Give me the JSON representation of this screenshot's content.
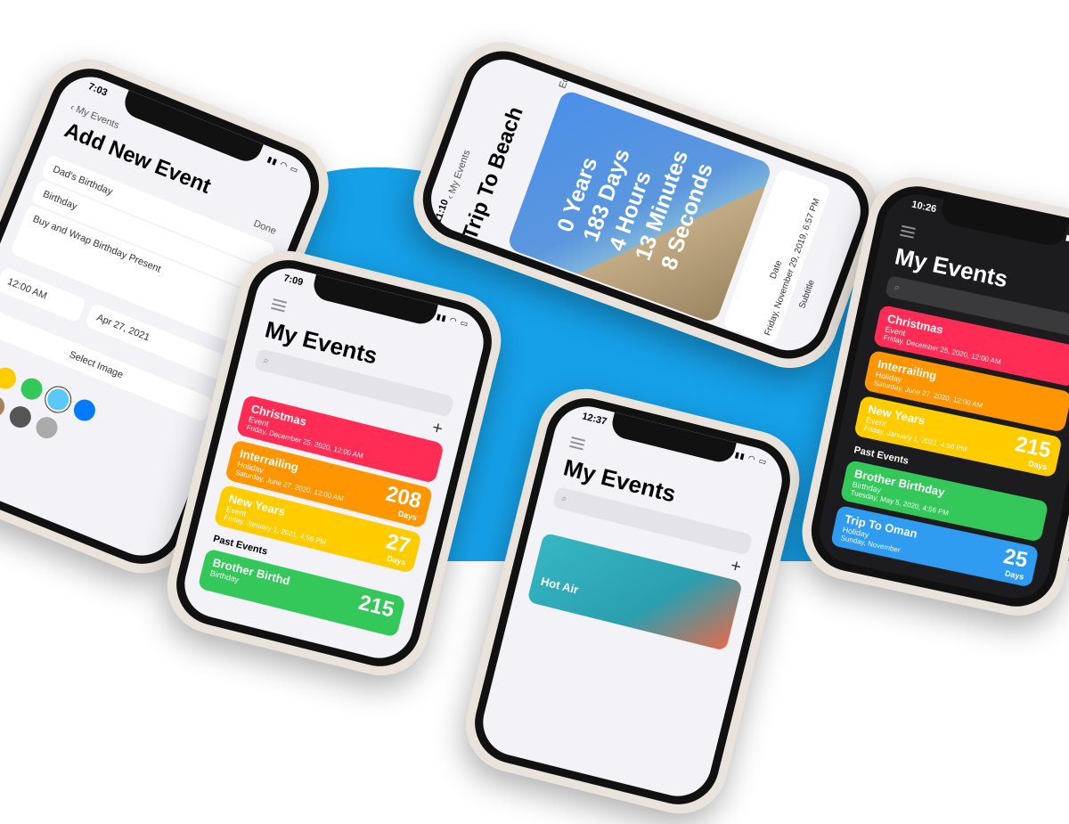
{
  "colors": {
    "background_blue": "#16a0e8",
    "event_red": "#ff2d55",
    "event_orange": "#ff9500",
    "event_yellow": "#ffcc00",
    "event_green": "#34c759",
    "event_blue": "#2f9cf2"
  },
  "phone_add": {
    "time": "7:03",
    "back_label": "My Events",
    "title": "Add New Event",
    "done_label": "Done",
    "name_value": "Dad's Birthday",
    "type_value": "Birthday",
    "notes_value": "Buy and Wrap Birthday Present",
    "time_value": "12:00 AM",
    "date_value": "Apr 27, 2021",
    "select_image_label": "Select Image",
    "swatch_colors": [
      "#ff9500",
      "#ffcc00",
      "#34c759",
      "#5ac8fa",
      "#007aff",
      "#af52de",
      "#a2845e",
      "#555555",
      "#aaaaaa"
    ]
  },
  "phone_list1": {
    "time": "7:09",
    "title": "My Events",
    "search_placeholder": "",
    "plus": "+",
    "events": [
      {
        "title": "Christmas",
        "type": "Event",
        "date": "Friday, December 25, 2020, 12:00 AM"
      },
      {
        "title": "Interrailing",
        "type": "Holiday",
        "date": "Saturday, June 27, 2020, 12:00 AM",
        "count": "208",
        "unit": "Days"
      },
      {
        "title": "New Years",
        "type": "Event",
        "date": "Friday, January 1, 2021, 4:56 PM",
        "count": "27",
        "unit": "Days"
      }
    ],
    "past_label": "Past Events",
    "past_events": [
      {
        "title": "Brother Birthd",
        "type": "Birthday",
        "count": "215"
      }
    ]
  },
  "phone_detail": {
    "time": "11:10",
    "back_label": "My Events",
    "title": "Trip To Beach",
    "edit_label": "Edit",
    "countdown": [
      "0 Years",
      "183 Days",
      "4 Hours",
      "13 Minutes",
      "8 Seconds"
    ],
    "date_label": "Date",
    "date_value": "Friday, November 29, 2019, 6:57 PM",
    "subtitle_label": "Subtitle"
  },
  "phone_list2": {
    "time": "12:37",
    "title": "My Events",
    "plus": "+",
    "card_title": "Hot Air"
  },
  "phone_dark": {
    "time": "10:26",
    "title": "My Events",
    "events": [
      {
        "title": "Christmas",
        "type": "Event",
        "date": "Friday, December 25, 2020, 12:00 AM"
      },
      {
        "title": "Interrailing",
        "type": "Holiday",
        "date": "Saturday, June 27, 2020, 12:00 AM"
      },
      {
        "title": "New Years",
        "type": "Event",
        "date": "Friday, January 1, 2021, 4:56 PM",
        "count": "215",
        "unit": "Days"
      }
    ],
    "past_label": "Past Events",
    "past_events": [
      {
        "title": "Brother Birthday",
        "type": "Birthday",
        "date": "Tuesday, May 5, 2020, 4:56 PM"
      },
      {
        "title": "Trip To Oman",
        "type": "Holiday",
        "date": "Sunday, November",
        "count": "25",
        "unit": "Days"
      }
    ]
  }
}
